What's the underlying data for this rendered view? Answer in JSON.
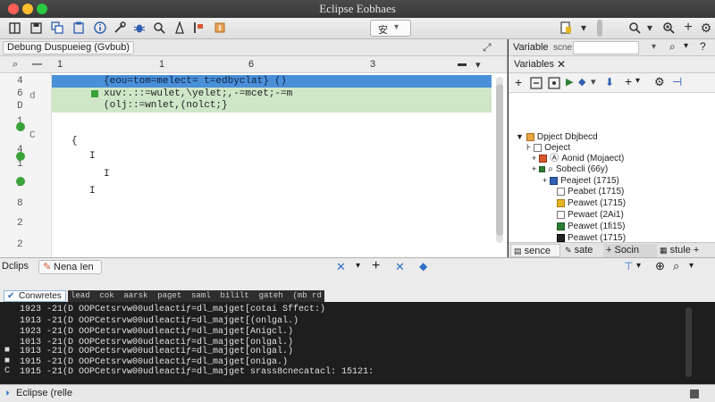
{
  "window": {
    "title": "Eclipse Eobhaes"
  },
  "toolbar": {
    "combo_label": "安"
  },
  "debug_pane": {
    "tab_label": "Debung Duspueieg (Gvbub)",
    "ruler": {
      "col1": "1",
      "col2": "1",
      "col3": "6",
      "col4": "3"
    },
    "gutter": [
      "4",
      "6",
      "D",
      "1",
      "4",
      "1",
      "1",
      "8",
      "2",
      "2"
    ],
    "gutter_side": [
      "d",
      "C"
    ],
    "code": {
      "line1": "{eou=tom=melect= t=edbyclat} ()",
      "line2": "xuv:.::=wulet,\\yelet;,-=mcet;-=m",
      "line3": "(olj::=wnlet,(nolct;}",
      "brace": "{",
      "mark1": "I",
      "mark2": "I",
      "mark3": "I"
    }
  },
  "variables_pane": {
    "header_label": "Variable",
    "header_side": "scne",
    "tab_label": "Variables",
    "tree": [
      "Dpject Dbjbecd",
      "Oeject",
      "Aonid (Mojaect)",
      "Sobecli (66y)",
      "Peajeet (1715)",
      "Peabet (1715)",
      "Peawet (1715)",
      "Pewaet (2Ai1)",
      "Peawet (1fi15)",
      "Peawet (1715)"
    ],
    "bottom_tabs": [
      "sence",
      "sate",
      "+ Socin",
      "stule +"
    ]
  },
  "console_pane": {
    "tab1": "Dclips",
    "tab2": "Nena Ien",
    "chip_label": "Conwretes",
    "filter_words": "lead  cok  aarsk  paget  saml  bililt  gateh  (mb rd",
    "lines": [
      "1923 -21(D OOPCetsrvw00udleactiƒ=dl_majget[cotai Sffect:)",
      "1913 -21(D OOPCetsrvw00udleactiƒ=dl_majget[(onlgal.)",
      "1923 -21(D OOPCetsrvw00udleactiƒ=dl_majget[Anigcl.)",
      "1013 -21(D OOPCetsrvw00udleactiƒ=dl_majget[onlgal.)",
      "1913 -21(D OOPCetsrvw00udleactiƒ=dl_majget[onlgal.)",
      "1915 -21(D OOPCetsrvw00udleactiƒ=dl_majget[oniga.)",
      "1915 -21(D OOPCetsrvw00udleactiƒ=dl_majget srass8cnecatacl: 15121:"
    ],
    "line_marks": [
      "",
      "",
      "",
      "",
      "■",
      "■",
      "C"
    ]
  },
  "statusbar": {
    "label": "Eclipse (relle"
  },
  "colors": {
    "highlight_current": "#4a90d9",
    "highlight_block": "#cfe6c7",
    "breakpoint": "#3aa23a",
    "console_bg": "#1e1e1e",
    "chip_accent": "#2f6fc4"
  }
}
